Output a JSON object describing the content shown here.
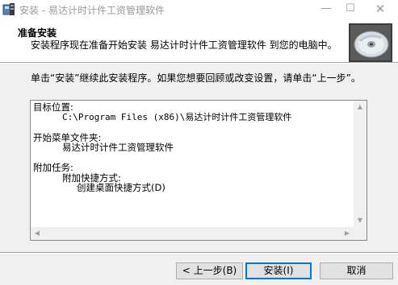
{
  "window": {
    "title": "安装 - 易达计时计件工资管理软件",
    "minimize_glyph": "—",
    "maximize_glyph": "☐",
    "close_glyph": "✕"
  },
  "header": {
    "title": "准备安装",
    "subtitle": "安装程序现在准备开始安装 易达计时计件工资管理软件 到您的电脑中。"
  },
  "instruction": "单击“安装”继续此安装程序。如果您想要回顾或改变设置，请单击“上一步”。",
  "memo": {
    "lines": [
      {
        "text": "目标位置:",
        "indent": 0
      },
      {
        "text": "C:\\Program Files (x86)\\易达计时计件工资管理软件",
        "indent": 1
      },
      {
        "text": "",
        "indent": 0
      },
      {
        "text": "开始菜单文件夹:",
        "indent": 0
      },
      {
        "text": "易达计时计件工资管理软件",
        "indent": 1
      },
      {
        "text": "",
        "indent": 0
      },
      {
        "text": "附加任务:",
        "indent": 0
      },
      {
        "text": "附加快捷方式:",
        "indent": 1
      },
      {
        "text": "创建桌面快捷方式(D)",
        "indent": 2
      }
    ]
  },
  "buttons": {
    "back": "< 上一步(B)",
    "install": "安装(I)",
    "cancel": "取消"
  },
  "icons": {
    "app": "installer-icon",
    "header": "cd-disc-icon"
  }
}
